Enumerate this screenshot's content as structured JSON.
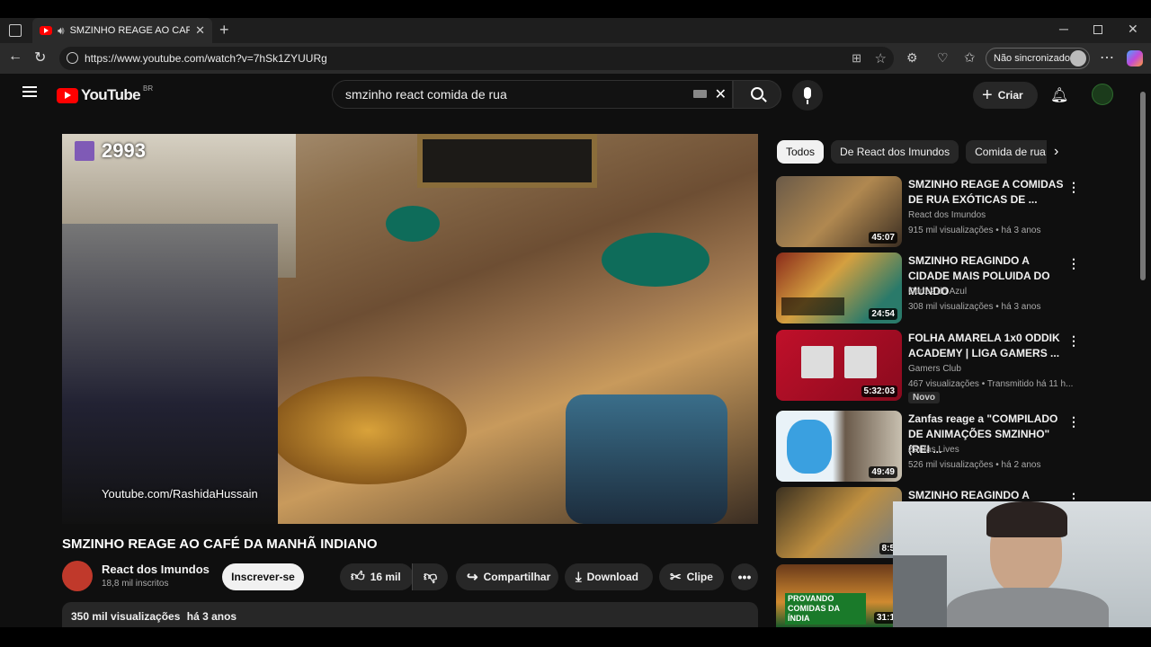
{
  "browser": {
    "tab_title": "SMZINHO REAGE AO CAFÉ D",
    "url": "https://www.youtube.com/watch?v=7hSk1ZYUURg",
    "profile_label": "Não sincronizado"
  },
  "youtube": {
    "logo_text": "YouTube",
    "region": "BR",
    "search_query": "smzinho react comida de rua",
    "create_label": "Criar",
    "video": {
      "overlay_counter": "2993",
      "watermark": "Youtube.com/RashidaHussain",
      "title": "SMZINHO REAGE AO CAFÉ DA MANHÃ INDIANO",
      "channel": "React dos Imundos",
      "subscribers": "18,8 mil inscritos",
      "subscribe_label": "Inscrever-se",
      "likes": "16 mil",
      "share_label": "Compartilhar",
      "download_label": "Download",
      "clip_label": "Clipe",
      "views": "350 mil visualizações",
      "age": "há 3 anos"
    },
    "chips": [
      "Todos",
      "De React dos Imundos",
      "Comida de rua"
    ],
    "recommendations": [
      {
        "title": "SMZINHO REAGE A COMIDAS DE RUA EXÓTICAS DE ...",
        "channel": "React dos Imundos",
        "meta": "915 mil visualizações • há 3 anos",
        "duration": "45:07",
        "badge": ""
      },
      {
        "title": "SMZINHO REAGINDO A CIDADE MAIS POLUIDA DO MUNDO",
        "channel": "Cortes do Azul",
        "meta": "308 mil visualizações • há 3 anos",
        "duration": "24:54",
        "badge": ""
      },
      {
        "title": "FOLHA AMARELA 1x0 ODDIK ACADEMY | LIGA GAMERS ...",
        "channel": "Gamers Club",
        "meta": "467 visualizações • Transmitido há 11 h...",
        "duration": "5:32:03",
        "badge": "Novo"
      },
      {
        "title": "Zanfas reage a \"COMPILADO DE ANIMAÇÕES SMZINHO\" (REI ...",
        "channel": "Zanfas Lives",
        "meta": "526 mil visualizações • há 2 anos",
        "duration": "49:49",
        "badge": ""
      },
      {
        "title": "SMZINHO REAGINDO A",
        "channel": "",
        "meta": "",
        "duration": "8:5",
        "badge": ""
      },
      {
        "title": "",
        "channel": "",
        "meta": "",
        "duration": "31:1",
        "badge": ""
      }
    ],
    "thumb6_text": "PROVANDO COMIDAS DA ÍNDIA"
  },
  "colors": {
    "accent_red": "#ff0000",
    "bg": "#0f0f0f",
    "chip_active": "#f1f1f1"
  }
}
